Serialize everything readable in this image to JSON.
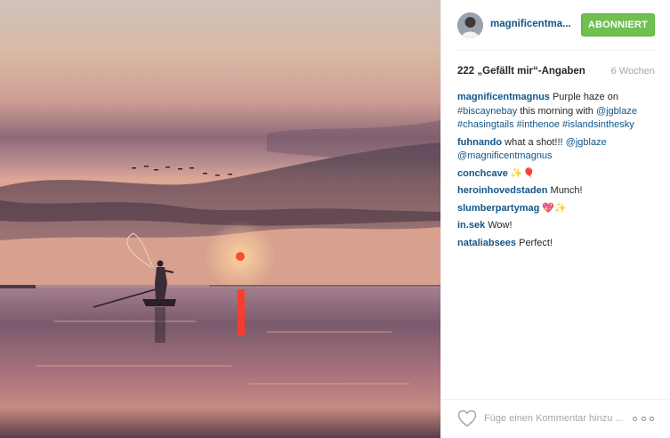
{
  "post": {
    "owner": {
      "username_display": "magnificentma...",
      "follow_label": "ABONNIERT"
    },
    "likes_label": "222 „Gefällt mir“-Angaben",
    "age_label": "6 Wochen",
    "comments": [
      {
        "user": "magnificentmagnus",
        "parts": [
          {
            "text": " Purple haze on ",
            "tag": false
          },
          {
            "text": "#biscaynebay",
            "tag": true
          },
          {
            "text": " this morning with ",
            "tag": false
          },
          {
            "text": "@jgblaze",
            "tag": true
          },
          {
            "text": " ",
            "tag": false
          },
          {
            "text": "#chasingtails",
            "tag": true
          },
          {
            "text": " ",
            "tag": false
          },
          {
            "text": "#inthenoe",
            "tag": true
          },
          {
            "text": " ",
            "tag": false
          },
          {
            "text": "#islandsinthesky",
            "tag": true
          }
        ]
      },
      {
        "user": "fuhnando",
        "parts": [
          {
            "text": " what a shot!!! ",
            "tag": false
          },
          {
            "text": "@jgblaze",
            "tag": true
          },
          {
            "text": " ",
            "tag": false
          },
          {
            "text": "@magnificentmagnus",
            "tag": true
          }
        ]
      },
      {
        "user": "conchcave",
        "parts": [
          {
            "text": " ✨🎈",
            "tag": false
          }
        ]
      },
      {
        "user": "heroinhovedstaden",
        "parts": [
          {
            "text": " Munch!",
            "tag": false
          }
        ]
      },
      {
        "user": "slumberpartymag",
        "parts": [
          {
            "text": " 💖✨",
            "tag": false
          }
        ]
      },
      {
        "user": "in.sek",
        "parts": [
          {
            "text": " Wow!",
            "tag": false
          }
        ]
      },
      {
        "user": "nataliabsees",
        "parts": [
          {
            "text": " Perfect!",
            "tag": false
          }
        ]
      }
    ],
    "comment_placeholder": "Füge einen Kommentar hinzu ...",
    "icons": {
      "like": "heart-outline-icon",
      "more": "more-options-icon"
    }
  },
  "colors": {
    "follow_button": "#70c050",
    "link": "#125688",
    "muted": "#a5a7aa",
    "text": "#262626"
  }
}
